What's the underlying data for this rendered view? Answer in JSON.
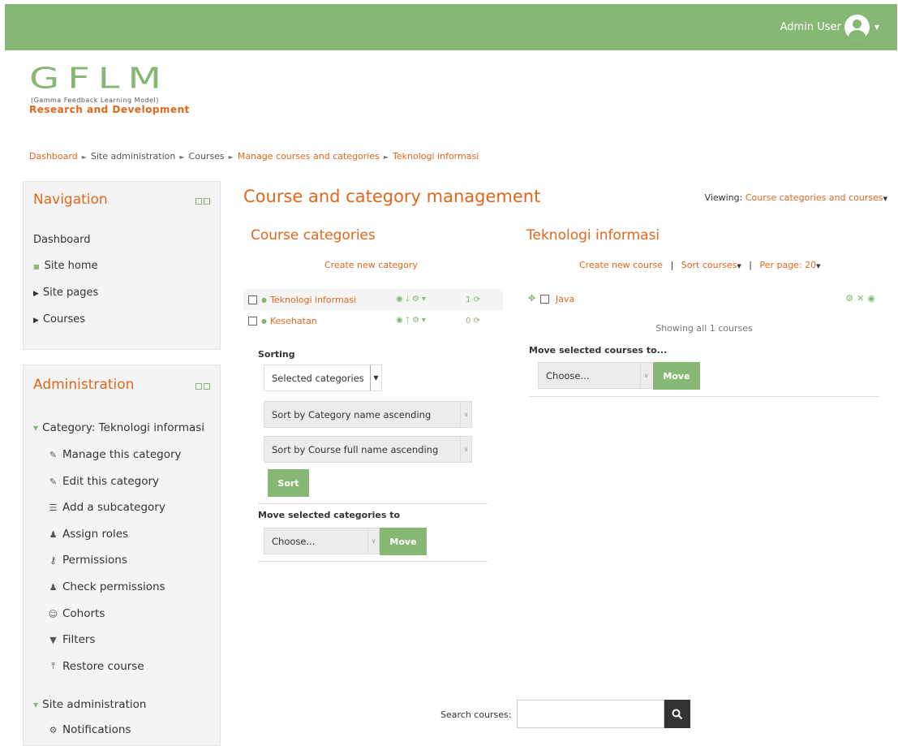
{
  "header": {
    "user_name": "Admin User"
  },
  "logo": {
    "big": "GFLM",
    "subtitle": "(Gamma Feedback Learning Model)",
    "tagline": "Research and Development"
  },
  "breadcrumb": [
    "Dashboard",
    "Site administration",
    "Courses",
    "Manage courses and categories",
    "Teknologi informasi"
  ],
  "navigation": {
    "title": "Navigation",
    "items": [
      "Dashboard",
      "Site home",
      "Site pages",
      "Courses"
    ]
  },
  "administration": {
    "title": "Administration",
    "category_header": "Category: Teknologi informasi",
    "items": [
      "Manage this category",
      "Edit this category",
      "Add a subcategory",
      "Assign roles",
      "Permissions",
      "Check permissions",
      "Cohorts",
      "Filters",
      "Restore course"
    ],
    "site_admin": "Site administration",
    "notifications": "Notifications"
  },
  "main": {
    "title": "Course and category management",
    "viewing_label": "Viewing:",
    "viewing_value": "Course categories and courses"
  },
  "categories": {
    "title": "Course categories",
    "create_link": "Create new category",
    "rows": [
      {
        "name": "Teknologi informasi",
        "count": "1"
      },
      {
        "name": "Kesehatan",
        "count": "0"
      }
    ],
    "sorting_label": "Sorting",
    "sort_select": "Selected categories",
    "sort_cat": "Sort by Category name ascending",
    "sort_course": "Sort by Course full name ascending",
    "sort_button": "Sort",
    "move_label": "Move selected categories to",
    "move_select": "Choose...",
    "move_button": "Move"
  },
  "courses": {
    "title": "Teknologi informasi",
    "create_link": "Create new course",
    "sep": "|",
    "sort_link": "Sort courses",
    "perpage_link": "Per page: 20",
    "rows": [
      {
        "name": "Java"
      }
    ],
    "showing": "Showing all 1 courses",
    "move_label": "Move selected courses to...",
    "move_select": "Choose...",
    "move_button": "Move"
  },
  "search": {
    "label": "Search courses:"
  },
  "colors": {
    "accent": "#e2661c",
    "brand_green": "#86b775"
  }
}
